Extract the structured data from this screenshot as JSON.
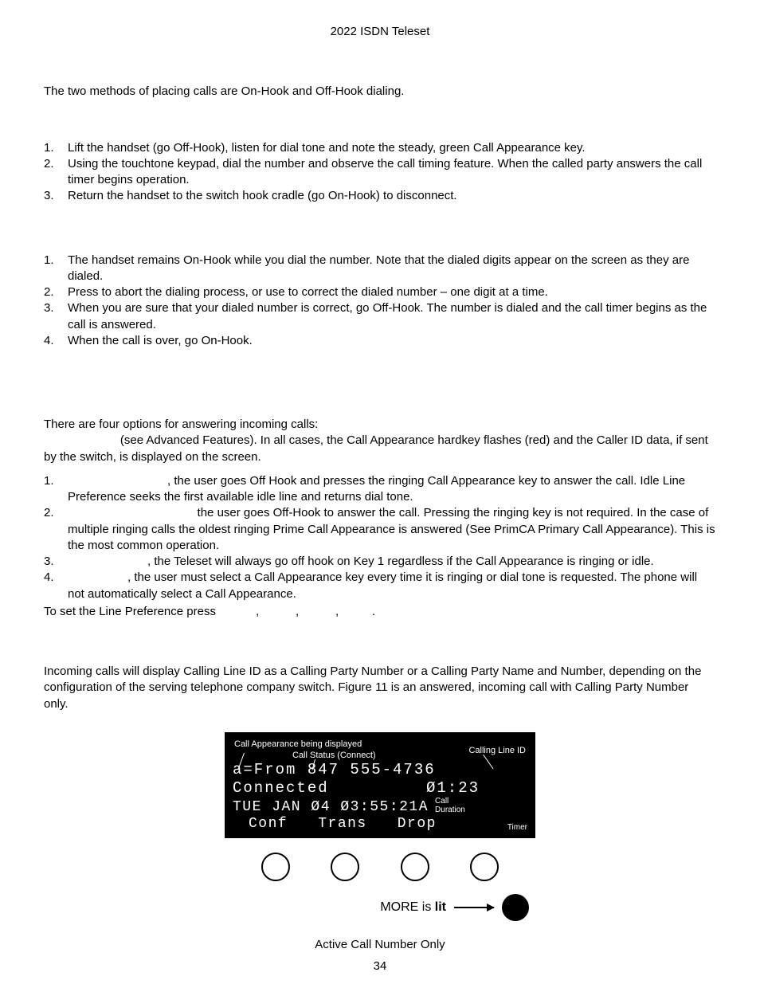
{
  "header": {
    "title": "2022 ISDN Teleset"
  },
  "intro": "The two methods of placing calls are On-Hook and Off-Hook dialing.",
  "offhook": {
    "items": [
      "Lift the handset (go Off-Hook), listen for dial tone and note the steady, green Call Appearance key.",
      "Using the touchtone keypad, dial the number and observe the call timing feature. When the called party answers the call timer begins operation.",
      "Return the handset to the switch hook cradle (go On-Hook) to disconnect."
    ]
  },
  "onhook": {
    "items": [
      "The handset remains On-Hook while you dial the number. Note that the dialed digits appear on the screen as they are dialed.",
      "Press           to abort the dialing process, or use           to correct the dialed number – one digit at a time.",
      "When you are sure that your dialed number is correct, go Off-Hook. The number is dialed and the call timer begins as the call is answered.",
      "When the call is over, go On-Hook."
    ]
  },
  "answer": {
    "intro1": "There are four options for answering incoming calls:",
    "intro2": "                       (see Advanced Features). In all cases, the Call Appearance hardkey flashes (red) and the Caller ID data, if sent by the switch, is displayed on the screen.",
    "items": [
      "                              , the user goes Off Hook and presses the ringing Call Appearance key to answer the call. Idle Line Preference seeks the first available idle line and returns dial tone.",
      "                                       the user goes Off-Hook to answer the call. Pressing the ringing key is not required. In the case of multiple ringing calls the oldest ringing Prime Call Appearance is answered (See PrimCA Primary Call Appearance). This is the most common operation.",
      "                        , the Teleset will always go off hook on Key 1 regardless if the Call Appearance is ringing or idle.",
      "                  , the user must select a Call Appearance key every time it is ringing or dial tone is requested. The phone will not automatically select a Call Appearance."
    ],
    "setpref": "To set the Line Preference press            ,           ,           ,          ."
  },
  "clid": {
    "para": "Incoming calls will display Calling Line ID as a Calling Party Number or a Calling Party Name and Number, depending on the configuration of the serving telephone company switch. Figure 11 is an answered, incoming call with Calling Party Number only."
  },
  "lcd": {
    "annot_ca": "Call Appearance being displayed",
    "annot_status": "Call Status (Connect)",
    "annot_clid": "Calling Line ID",
    "line1": "a=From 847 555-4736",
    "line2_left": "Connected",
    "line2_right": "Ø1:23",
    "line3": "TUE JAN Ø4 Ø3:55:21A",
    "side_call": "Call",
    "side_dur": "Duration",
    "side_timer": "Timer",
    "sk1": "Conf",
    "sk2": "Trans",
    "sk3": "Drop",
    "more_label": "MORE is ",
    "more_lit": "lit"
  },
  "figure_caption": "Active Call Number Only",
  "page_number": "34"
}
